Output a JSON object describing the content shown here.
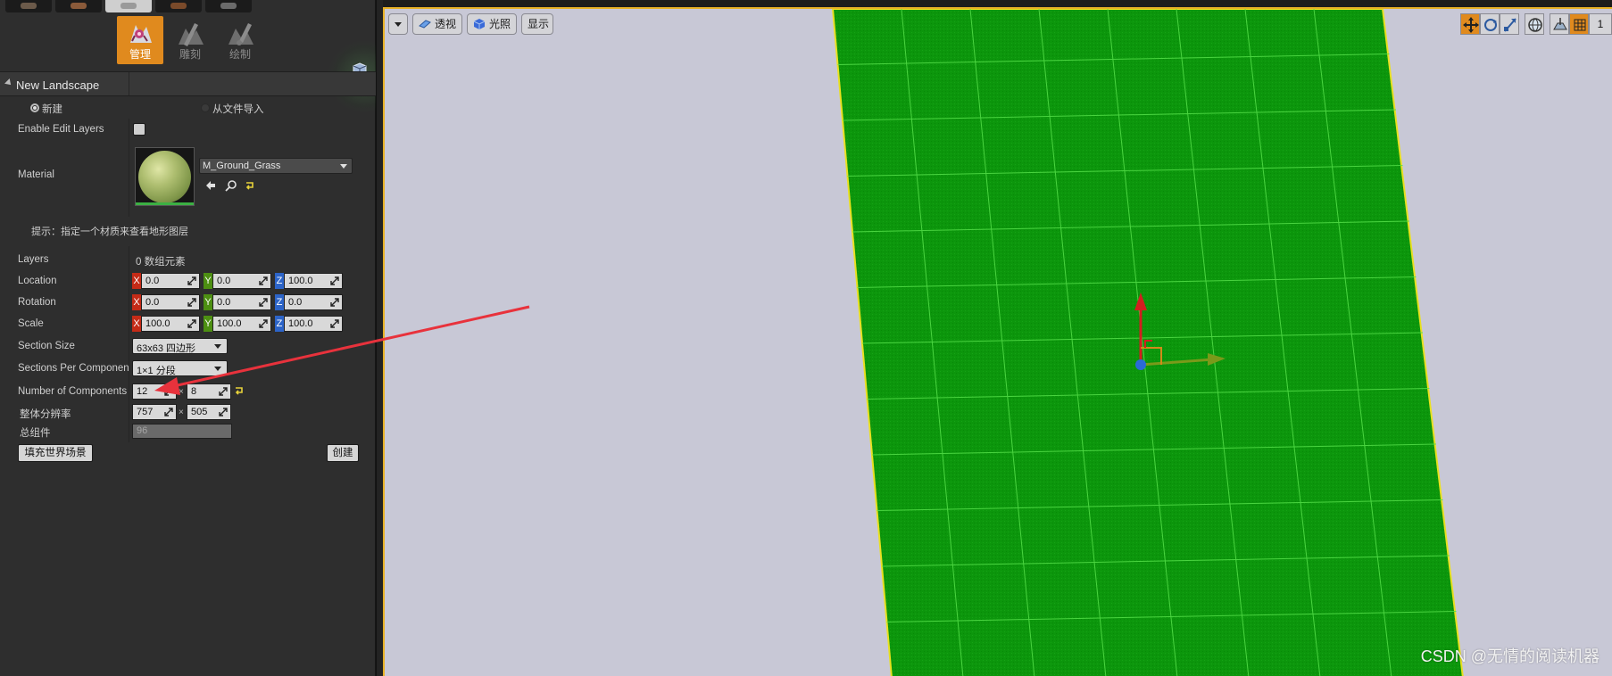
{
  "modes": {
    "tools": [
      {
        "label": "管理",
        "active": true
      },
      {
        "label": "雕刻",
        "active": false
      },
      {
        "label": "绘制",
        "active": false
      }
    ]
  },
  "section": {
    "title": "New Landscape"
  },
  "source": {
    "new_label": "新建",
    "import_label": "从文件导入",
    "selected": "新建"
  },
  "props": {
    "enable_edit_layers_label": "Enable Edit Layers",
    "enable_edit_layers_checked": false,
    "material_label": "Material",
    "material_value": "M_Ground_Grass",
    "hint": "提示：指定一个材质来查看地形图层",
    "layers_label": "Layers",
    "layers_value": "0 数组元素",
    "location_label": "Location",
    "location": {
      "x": "0.0",
      "y": "0.0",
      "z": "100.0"
    },
    "rotation_label": "Rotation",
    "rotation": {
      "x": "0.0",
      "y": "0.0",
      "z": "0.0"
    },
    "scale_label": "Scale",
    "scale": {
      "x": "100.0",
      "y": "100.0",
      "z": "100.0"
    },
    "section_size_label": "Section Size",
    "section_size_value": "63x63 四边形",
    "sections_per_component_label": "Sections Per Component",
    "sections_per_component_value": "1×1 分段",
    "num_components_label": "Number of Components",
    "num_components": {
      "x": "12",
      "y": "8"
    },
    "resolution_label": "整体分辨率",
    "resolution": {
      "x": "757",
      "y": "505"
    },
    "total_components_label": "总组件",
    "total_components_value": "96",
    "axis_letters": {
      "x": "X",
      "y": "Y",
      "z": "Z"
    },
    "times_sign": "×"
  },
  "buttons": {
    "fill_world": "填充世界场景",
    "create": "创建"
  },
  "viewport": {
    "perspective_label": "透视",
    "lit_label": "光照",
    "show_label": "显示",
    "watermark": "CSDN @无情的阅读机器",
    "right_tool_digit": "1"
  },
  "colors": {
    "accent": "#e08a1e",
    "viewport_bg": "#c8c8d6",
    "terrain": "#0f9a0f",
    "terrain_grid": "#55e04a",
    "terrain_edge": "#e8e020",
    "arrow_annotation": "#e8323c"
  }
}
